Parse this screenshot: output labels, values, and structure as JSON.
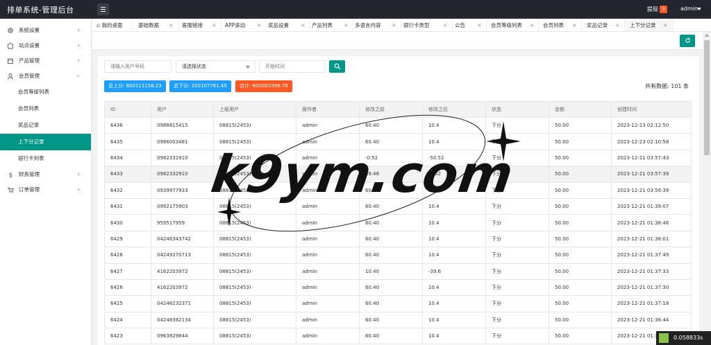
{
  "header": {
    "brand": "排单系统-管理后台",
    "withdraw_label": "提现",
    "withdraw_count": "3",
    "admin_label": "admin"
  },
  "sidebar": {
    "items": [
      {
        "label": "系统设置",
        "icon": "gear-icon"
      },
      {
        "label": "站点设置",
        "icon": "site-icon"
      },
      {
        "label": "产品管理",
        "icon": "product-icon"
      },
      {
        "label": "会员管理",
        "icon": "user-icon"
      }
    ],
    "member_sub": [
      "会员等级列表",
      "会员列表",
      "奖品记录",
      "上下分记录",
      "银行卡列表"
    ],
    "active_sub": "上下分记录",
    "bottom_items": [
      {
        "label": "财务管理",
        "icon": "dollar-icon"
      },
      {
        "label": "订单管理",
        "icon": "order-icon"
      }
    ]
  },
  "tabs": [
    {
      "label": "我的桌面",
      "closable": false
    },
    {
      "label": "基础数据",
      "closable": true
    },
    {
      "label": "客服链接",
      "closable": true
    },
    {
      "label": "APP滚动",
      "closable": true
    },
    {
      "label": "奖品设置",
      "closable": true
    },
    {
      "label": "产品列表",
      "closable": true
    },
    {
      "label": "多语言内容",
      "closable": true
    },
    {
      "label": "银行卡类型",
      "closable": true
    },
    {
      "label": "公告",
      "closable": true
    },
    {
      "label": "会员等级列表",
      "closable": true
    },
    {
      "label": "会员列表",
      "closable": true
    },
    {
      "label": "奖品记录",
      "closable": true
    },
    {
      "label": "上下分记录",
      "closable": true,
      "active": true
    }
  ],
  "filters": {
    "phone_placeholder": "请输入用户号码",
    "status_placeholder": "请选择状态",
    "time_placeholder": "开始时间"
  },
  "stats": {
    "up_total": "总上分: 800111158.23",
    "down_total": "总下分: 200107761.45",
    "sum": "合计: 600003396.78",
    "count": "共有数据: 101 条"
  },
  "colors": {
    "accent": "#009688",
    "blue": "#1e9fff",
    "orange": "#ff5722",
    "topbar": "#23262e"
  },
  "table": {
    "columns": [
      "ID",
      "用户",
      "上级用户",
      "操作者",
      "修改之前",
      "修改之后",
      "状态",
      "金额",
      "创建时间"
    ],
    "rows": [
      [
        "6436",
        "0988815415",
        "08815(2453)",
        "admin",
        "60.40",
        "10.4",
        "下分",
        "50.00",
        "2023-12-23 02:12:50"
      ],
      [
        "6435",
        "0986003481",
        "08815(2453)",
        "admin",
        "60.40",
        "10.4",
        "下分",
        "50.00",
        "2023-12-23 02:10:58"
      ],
      [
        "6434",
        "0982332910",
        "08815(2453)",
        "admin",
        "-0.52",
        "-50.52",
        "下分",
        "50.00",
        "2023-12-21 03:57:43"
      ],
      [
        "6433",
        "0982332910",
        "08815(2453)",
        "admin",
        "49.48",
        "-0.52",
        "下分",
        "50.00",
        "2023-12-21 03:57:39"
      ],
      [
        "6432",
        "0939977933",
        "08815(2453)",
        "admin",
        "60.40",
        "10.4",
        "下分",
        "50.00",
        "2023-12-21 03:56:39"
      ],
      [
        "6431",
        "0992175903",
        "08815(2453)",
        "admin",
        "60.40",
        "10.4",
        "下分",
        "50.00",
        "2023-12-21 01:39:07"
      ],
      [
        "6430",
        "959517959",
        "08815(2453)",
        "admin",
        "60.40",
        "10.4",
        "下分",
        "50.00",
        "2023-12-21 01:38:46"
      ],
      [
        "6429",
        "04246343742",
        "08815(2453)",
        "admin",
        "60.40",
        "10.4",
        "下分",
        "50.00",
        "2023-12-21 01:38:01"
      ],
      [
        "6428",
        "04249270713",
        "08815(2453)",
        "admin",
        "60.40",
        "10.4",
        "下分",
        "50.00",
        "2023-12-21 01:37:49"
      ],
      [
        "6427",
        "4162203972",
        "08815(2453)",
        "admin",
        "10.40",
        "-39.6",
        "下分",
        "50.00",
        "2023-12-21 01:37:33"
      ],
      [
        "6426",
        "4162203972",
        "08815(2453)",
        "admin",
        "60.40",
        "10.4",
        "下分",
        "50.00",
        "2023-12-21 01:37:30"
      ],
      [
        "6425",
        "04246232371",
        "08815(2453)",
        "admin",
        "60.40",
        "10.4",
        "下分",
        "50.00",
        "2023-12-21 01:37:18"
      ],
      [
        "6424",
        "04248382134",
        "08815(2453)",
        "admin",
        "60.40",
        "10.4",
        "下分",
        "50.00",
        "2023-12-21 01:36:44"
      ],
      [
        "6423",
        "0963829844",
        "08815(2453)",
        "admin",
        "60.40",
        "10.4",
        "下分",
        "50.00",
        "2023-12-21 01:36:14"
      ]
    ],
    "highlighted_row": 3
  },
  "watermark": "k9ym.com",
  "timing": "0.058833s"
}
